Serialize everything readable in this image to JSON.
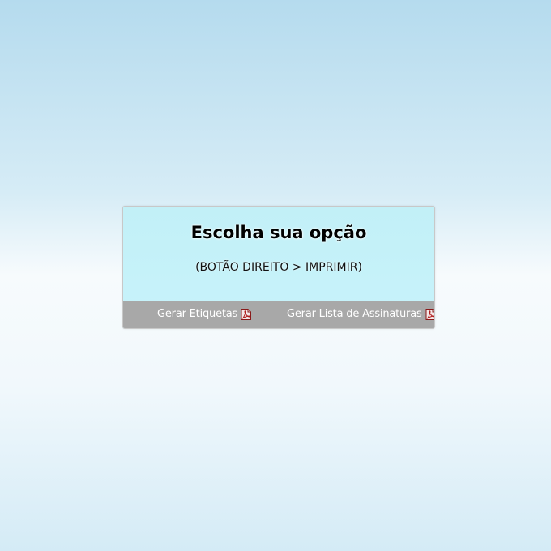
{
  "dialog": {
    "title": "Escolha sua opção",
    "subtitle": "(BOTÃO DIREITO > IMPRIMIR)"
  },
  "footer": {
    "links": [
      {
        "label": "Gerar Etiquetas",
        "icon": "pdf-icon"
      },
      {
        "label": "Gerar Lista de Assinaturas",
        "icon": "pdf-icon"
      }
    ]
  },
  "colors": {
    "footer_bg": "#a8a8a8",
    "dialog_bg": "#c4f1f8",
    "pdf_icon": "#b01e1e"
  }
}
